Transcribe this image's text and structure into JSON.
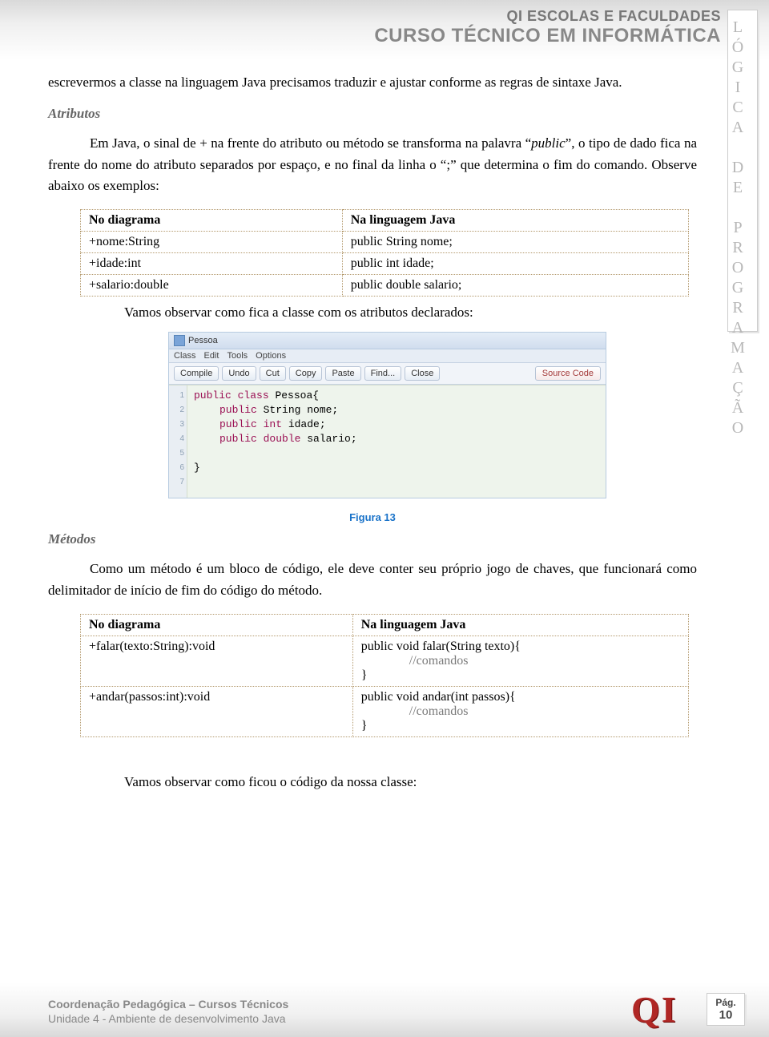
{
  "header": {
    "line1": "QI ESCOLAS E FACULDADES",
    "line2": "CURSO TÉCNICO EM INFORMÁTICA"
  },
  "sidebar_label": "LÓGICA DE PROGRAMAÇÃO",
  "intro_para": "escrevermos a classe na linguagem Java precisamos traduzir e ajustar conforme as regras de sintaxe Java.",
  "sec_atributos": {
    "title": "Atributos",
    "para_pre": "Em Java, o sinal de + na frente do atributo ou método se transforma na palavra “",
    "italic": "public",
    "para_post": "”, o tipo de dado fica na frente do nome do atributo separados por espaço, e no final da linha o “;” que determina o fim do comando. Observe abaixo os exemplos:"
  },
  "table1": {
    "head_l": "No diagrama",
    "head_r": "Na linguagem Java",
    "rows": [
      {
        "l": "+nome:String",
        "r": "public String nome;"
      },
      {
        "l": "+idade:int",
        "r": "public int idade;"
      },
      {
        "l": "+salario:double",
        "r": "public double salario;"
      }
    ]
  },
  "obs1": "Vamos observar como fica a classe com os atributos declarados:",
  "editor": {
    "title": "Pessoa",
    "menu": {
      "class": "Class",
      "edit": "Edit",
      "tools": "Tools",
      "options": "Options"
    },
    "buttons": {
      "compile": "Compile",
      "undo": "Undo",
      "cut": "Cut",
      "copy": "Copy",
      "paste": "Paste",
      "find": "Find...",
      "close": "Close"
    },
    "source_label": "Source Code",
    "lines": [
      "1",
      "2",
      "3",
      "4",
      "5",
      "6",
      "7"
    ],
    "code": {
      "l1_kw1": "public",
      "l1_kw2": "class",
      "l1_name": " Pessoa{",
      "l2_kw": "public",
      "l2_rest": " String nome;",
      "l3_kw": "public",
      "l3_kw2": " int",
      "l3_rest": " idade;",
      "l4_kw": "public",
      "l4_kw2": " double",
      "l4_rest": " salario;",
      "l5": "",
      "l6": "}"
    }
  },
  "figure_caption": "Figura 13",
  "sec_metodos": {
    "title": "Métodos",
    "para": "Como um método é um bloco de código, ele deve conter seu próprio jogo de chaves, que funcionará como delimitador de início de fim do código do método."
  },
  "table2": {
    "head_l": "No diagrama",
    "head_r": "Na linguagem Java",
    "rows": [
      {
        "l": "+falar(texto:String):void",
        "r1": "public void falar(String texto){",
        "rc": "//comandos",
        "r3": "}"
      },
      {
        "l": "+andar(passos:int):void",
        "r1": "public void andar(int passos){",
        "rc": "//comandos",
        "r3": "}"
      }
    ]
  },
  "obs2": "Vamos observar como ficou o código da nossa classe:",
  "footer": {
    "l1": "Coordenação Pedagógica – Cursos Técnicos",
    "l2": "Unidade 4 - Ambiente de desenvolvimento Java",
    "page_label": "Pág.",
    "page_num": "10"
  }
}
